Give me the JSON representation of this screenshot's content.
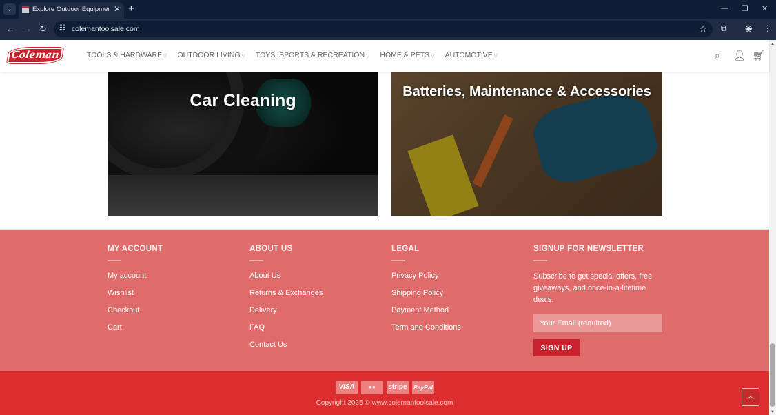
{
  "browser": {
    "tab_title": "Explore Outdoor Equipment & S",
    "url": "colemantoolsale.com",
    "icons": [
      "tab-search-icon",
      "close-icon",
      "plus-icon",
      "minimize-icon",
      "restore-icon",
      "back-icon",
      "forward-icon",
      "reload-icon",
      "site-info-icon",
      "star-icon",
      "extensions-icon",
      "profile-icon",
      "menu-icon"
    ]
  },
  "header": {
    "logo_text": "Coleman",
    "menu": [
      {
        "label": "TOOLS & HARDWARE"
      },
      {
        "label": "OUTDOOR LIVING"
      },
      {
        "label": "TOYS, SPORTS & RECREATION"
      },
      {
        "label": "HOME & PETS"
      },
      {
        "label": "AUTOMOTIVE"
      }
    ],
    "icons": [
      "search-icon",
      "user-icon",
      "cart-icon"
    ]
  },
  "banners": {
    "car_cleaning": "Car Cleaning",
    "batteries": "Batteries, Maintenance & Accessories"
  },
  "footer": {
    "account": {
      "title": "MY ACCOUNT",
      "links": [
        "My account",
        "Wishlist",
        "Checkout",
        "Cart"
      ]
    },
    "about": {
      "title": "ABOUT US",
      "links": [
        "About Us",
        "Returns & Exchanges",
        "Delivery",
        "FAQ",
        "Contact Us"
      ]
    },
    "legal": {
      "title": "LEGAL",
      "links": [
        "Privacy Policy",
        "Shipping Policy",
        "Payment Method",
        "Term and Conditions"
      ]
    },
    "newsletter": {
      "title": "SIGNUP FOR NEWSLETTER",
      "description": "Subscribe to get special offers, free giveaways, and once-in-a-lifetime deals.",
      "email_placeholder": "Your Email (required)",
      "button": "SIGN UP"
    },
    "payments": [
      "VISA",
      "●●",
      "stripe",
      "PayPal"
    ],
    "copyright": "Copyright 2025 © www.colemantoolsale.com"
  },
  "colors": {
    "brand_red": "#c8232c",
    "footer_bg": "#df6b6b",
    "bottom_bar": "#dc2e2e",
    "browser_chrome": "#1f2c44"
  }
}
